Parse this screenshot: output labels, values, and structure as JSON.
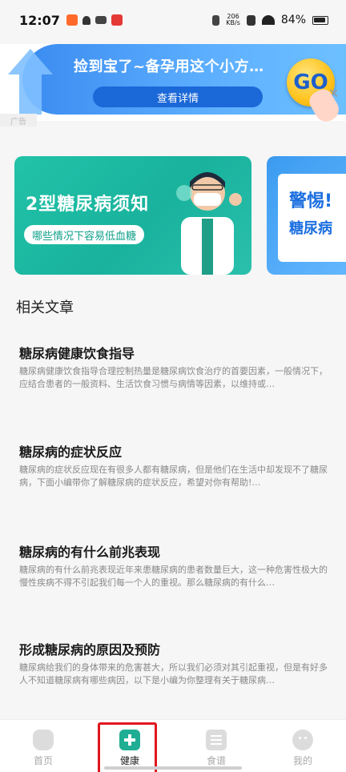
{
  "status_bar": {
    "time": "12:07",
    "net_speed_value": "206",
    "net_speed_unit": "KB/s",
    "battery": "84%"
  },
  "ad": {
    "title": "捡到宝了~备孕用这个小方…",
    "button": "查看详情",
    "go": "GO",
    "label": "广告"
  },
  "cards": [
    {
      "title": "2型糖尿病须知",
      "pill": "哪些情况下容易低血糖"
    },
    {
      "title": "警惕!",
      "subtitle": "糖尿病"
    }
  ],
  "section_title": "相关文章",
  "articles": [
    {
      "title": "糖尿病健康饮食指导",
      "desc": "糖尿病健康饮食指导合理控制热量是糖尿病饮食治疗的首要因素，一般情况下，应结合患者的一般资料、生活饮食习惯与病情等因素，以维持或…"
    },
    {
      "title": "糖尿病的症状反应",
      "desc": "糖尿病的症状反应现在有很多人都有糖尿病，但是他们在生活中却发现不了糖尿病，下面小编带你了解糖尿病的症状反应，希望对你有帮助!…"
    },
    {
      "title": "糖尿病的有什么前兆表现",
      "desc": "糖尿病的有什么前兆表现近年来患糖尿病的患者数量巨大，这一种危害性极大的慢性疾病不得不引起我们每一个人的重视。那么糖尿病的有什么…"
    },
    {
      "title": "形成糖尿病的原因及预防",
      "desc": "糖尿病给我们的身体带来的危害甚大，所以我们必须对其引起重视，但是有好多人不知道糖尿病有哪些病因，以下是小编为你整理有关于糖尿病…"
    }
  ],
  "nav": [
    {
      "label": "首页",
      "icon": "home-icon"
    },
    {
      "label": "健康",
      "icon": "medical-kit-icon",
      "active": true
    },
    {
      "label": "食谱",
      "icon": "recipe-list-icon"
    },
    {
      "label": "我的",
      "icon": "profile-face-icon"
    }
  ],
  "colors": {
    "accent": "#1fae93",
    "highlight": "#e0161e",
    "ad_blue": "#3a8bf0"
  }
}
